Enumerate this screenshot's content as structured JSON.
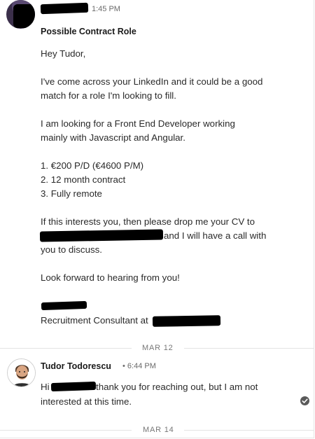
{
  "message_1": {
    "time": "1:45 PM",
    "subject": "Possible Contract Role",
    "greeting": "Hey Tudor,",
    "p1_line1": "I've come across your LinkedIn and it could be a good",
    "p1_line2": "match for a role I'm looking to fill.",
    "p2_line1": "I am looking for a Front End Developer working",
    "p2_line2": "mainly with Javascript and Angular.",
    "list": [
      "1. €200 P/D (€4600 P/M)",
      "2. 12 month contract",
      "3. Fully remote"
    ],
    "p3_line1": "If this interests you, then please drop me your CV to",
    "p3_line2_tail": "and I will have a call with",
    "p3_line3": "you to discuss.",
    "closing": "Look forward to hearing from you!",
    "signature_title": "Recruitment Consultant at"
  },
  "separators": {
    "first": "MAR 12",
    "second": "MAR 14"
  },
  "message_2": {
    "sender": "Tudor Todorescu",
    "time": "• 6:44 PM",
    "line1_prefix": "Hi",
    "line1_tail": "thank you for reaching out, but I am not",
    "line2": "interested at this time."
  },
  "icons": {
    "read_receipt": "check-circle-icon",
    "avatar_1": "avatar",
    "avatar_2": "avatar"
  }
}
